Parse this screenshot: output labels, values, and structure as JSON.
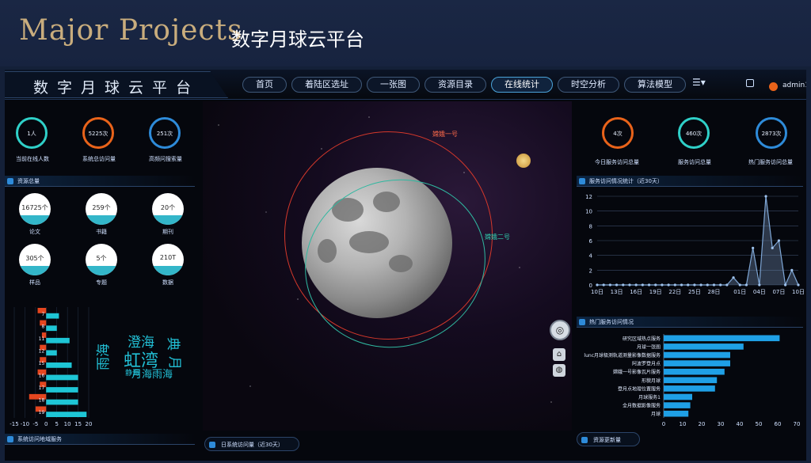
{
  "slide": {
    "title_en": "Major Projects",
    "title_cn": "数字月球云平台"
  },
  "header": {
    "brand": "数字月球云平台",
    "tabs": [
      {
        "label": "首页"
      },
      {
        "label": "着陆区选址"
      },
      {
        "label": "一张图"
      },
      {
        "label": "资源目录"
      },
      {
        "label": "在线统计",
        "active": true
      },
      {
        "label": "时空分析"
      },
      {
        "label": "算法模型"
      }
    ],
    "user": "admin1"
  },
  "left": {
    "rings": [
      {
        "value": "1人",
        "caption": "当前在线人数",
        "color": "#2fd0c8"
      },
      {
        "value": "5225次",
        "caption": "系统总访问量",
        "color": "#e9631a"
      },
      {
        "value": "251次",
        "caption": "高频问搜索量",
        "color": "#2e8bd9"
      }
    ],
    "resources_title": "资源总量",
    "resources": [
      {
        "value": "16725个",
        "caption": "论文"
      },
      {
        "value": "259个",
        "caption": "书籍"
      },
      {
        "value": "20个",
        "caption": "期刊"
      },
      {
        "value": "305个",
        "caption": "样品"
      },
      {
        "value": "5个",
        "caption": "专题"
      },
      {
        "value": "210T",
        "caption": "数据"
      }
    ],
    "wordcloud": [
      "雨海",
      "澄海",
      "虹湾",
      "典",
      "月",
      "静海",
      "月海雨海"
    ],
    "bottom_title": "系统访问地域服务"
  },
  "center": {
    "sat1": "嫦娥一号",
    "sat2": "嫦娥二号",
    "bottom_title": "日系统访问量（近30天）"
  },
  "right": {
    "rings": [
      {
        "value": "4次",
        "caption": "今日服务访问总量",
        "color": "#e9631a"
      },
      {
        "value": "460次",
        "caption": "服务访问总量",
        "color": "#2fd0c8"
      },
      {
        "value": "2873次",
        "caption": "热门服务访问总量",
        "color": "#2e8bd9"
      }
    ],
    "line_title": "服务访问情况统计（近30天）",
    "bar_title": "热门服务访问情况",
    "bottom_title": "资源更新量"
  },
  "chart_data": [
    {
      "type": "line",
      "title": "服务访问情况统计（近30天）",
      "x": [
        "10日",
        "11日",
        "12日",
        "13日",
        "14日",
        "15日",
        "16日",
        "17日",
        "18日",
        "19日",
        "20日",
        "21日",
        "22日",
        "23日",
        "24日",
        "25日",
        "26日",
        "27日",
        "28日",
        "29日",
        "30日",
        "31日",
        "01日",
        "02日",
        "03日",
        "04日",
        "05日",
        "06日",
        "07日",
        "08日",
        "09日",
        "10日"
      ],
      "values": [
        0,
        0,
        0,
        0,
        0,
        0,
        0,
        0,
        0,
        0,
        0,
        0,
        0,
        0,
        0,
        0,
        0,
        0,
        0,
        0,
        0,
        1,
        0,
        0,
        5,
        0,
        12,
        5,
        6,
        0,
        2,
        0
      ],
      "tick_labels": [
        "10日",
        "13日",
        "16日",
        "19日",
        "22日",
        "25日",
        "28日",
        "01日",
        "04日",
        "07日",
        "10日"
      ],
      "ylim": [
        0,
        12
      ],
      "yticks": [
        0,
        2,
        4,
        6,
        8,
        10,
        12
      ]
    },
    {
      "type": "bar",
      "orientation": "horizontal",
      "title": "热门服务访问情况",
      "categories": [
        "研究区域热点服务",
        "月球一张图",
        "lunc月球极测轨道测量影像数据服务",
        "阿波罗登月点",
        "嫦娥一号影像瓦片服务",
        "形貌月球",
        "登月点地理位置服务",
        "月球服务1",
        "全月数据影像服务",
        "月球"
      ],
      "values": [
        61,
        42,
        35,
        35,
        32,
        28,
        27,
        15,
        14,
        13
      ],
      "xlim": [
        0,
        70
      ],
      "xticks": [
        0,
        10,
        20,
        30,
        40,
        50,
        60,
        70
      ]
    },
    {
      "type": "bar",
      "orientation": "horizontal",
      "title": "",
      "categories": [
        "7",
        "8",
        "11",
        "12",
        "15",
        "16",
        "17",
        "18",
        "19"
      ],
      "series": [
        {
          "values": [
            -4,
            -3,
            -2,
            -3,
            -3,
            -4,
            -3,
            -8,
            -5
          ]
        },
        {
          "values": [
            6,
            5,
            11,
            5,
            12,
            15,
            15,
            15,
            19
          ]
        }
      ],
      "xlim": [
        -15,
        20
      ],
      "xticks": [
        -15,
        -10,
        -5,
        0,
        5,
        10,
        15,
        20
      ]
    }
  ]
}
